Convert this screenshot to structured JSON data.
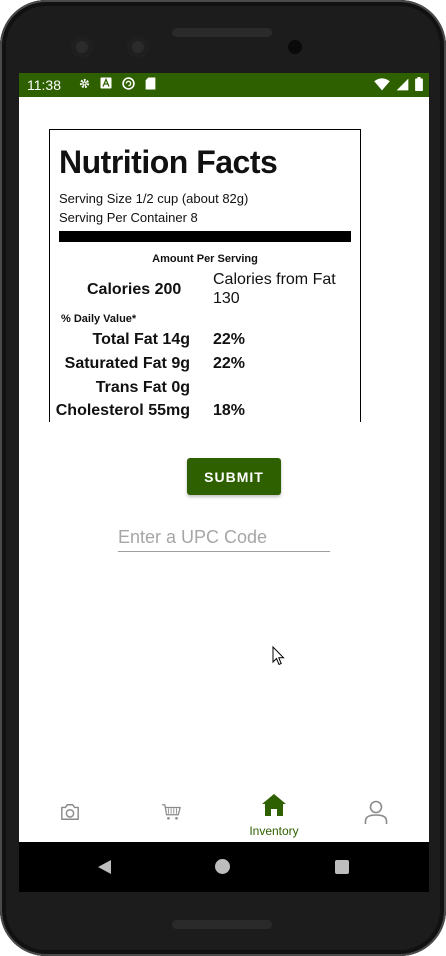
{
  "status_bar": {
    "time": "11:38",
    "left_icons": [
      "gear-icon",
      "a-icon",
      "sync-icon",
      "sd-card-icon"
    ],
    "right_icons": [
      "wifi-icon",
      "signal-icon",
      "battery-icon"
    ]
  },
  "nutrition": {
    "title": "Nutrition Facts",
    "serving_size": "Serving Size 1/2 cup (about 82g)",
    "serving_per_container": "Serving Per Container 8",
    "amount_per_serving": "Amount Per Serving",
    "calories": "Calories 200",
    "calories_from_fat": "Calories from Fat 130",
    "daily_value": "% Daily Value*",
    "rows": [
      {
        "label": "Total Fat 14g",
        "pct": "22%"
      },
      {
        "label": "Saturated Fat 9g",
        "pct": "22%"
      },
      {
        "label": "Trans Fat 0g",
        "pct": ""
      },
      {
        "label": "Cholesterol 55mg",
        "pct": "18%"
      }
    ]
  },
  "submit_label": "SUBMIT",
  "upc": {
    "placeholder": "Enter a UPC Code",
    "value": ""
  },
  "bottom_nav": {
    "items": [
      {
        "icon": "camera-icon",
        "label": ""
      },
      {
        "icon": "cart-icon",
        "label": ""
      },
      {
        "icon": "home-icon",
        "label": "Inventory",
        "active": true
      },
      {
        "icon": "person-icon",
        "label": ""
      }
    ]
  },
  "colors": {
    "primary": "#2f6000",
    "inactive_icon": "#8a8a8a"
  }
}
